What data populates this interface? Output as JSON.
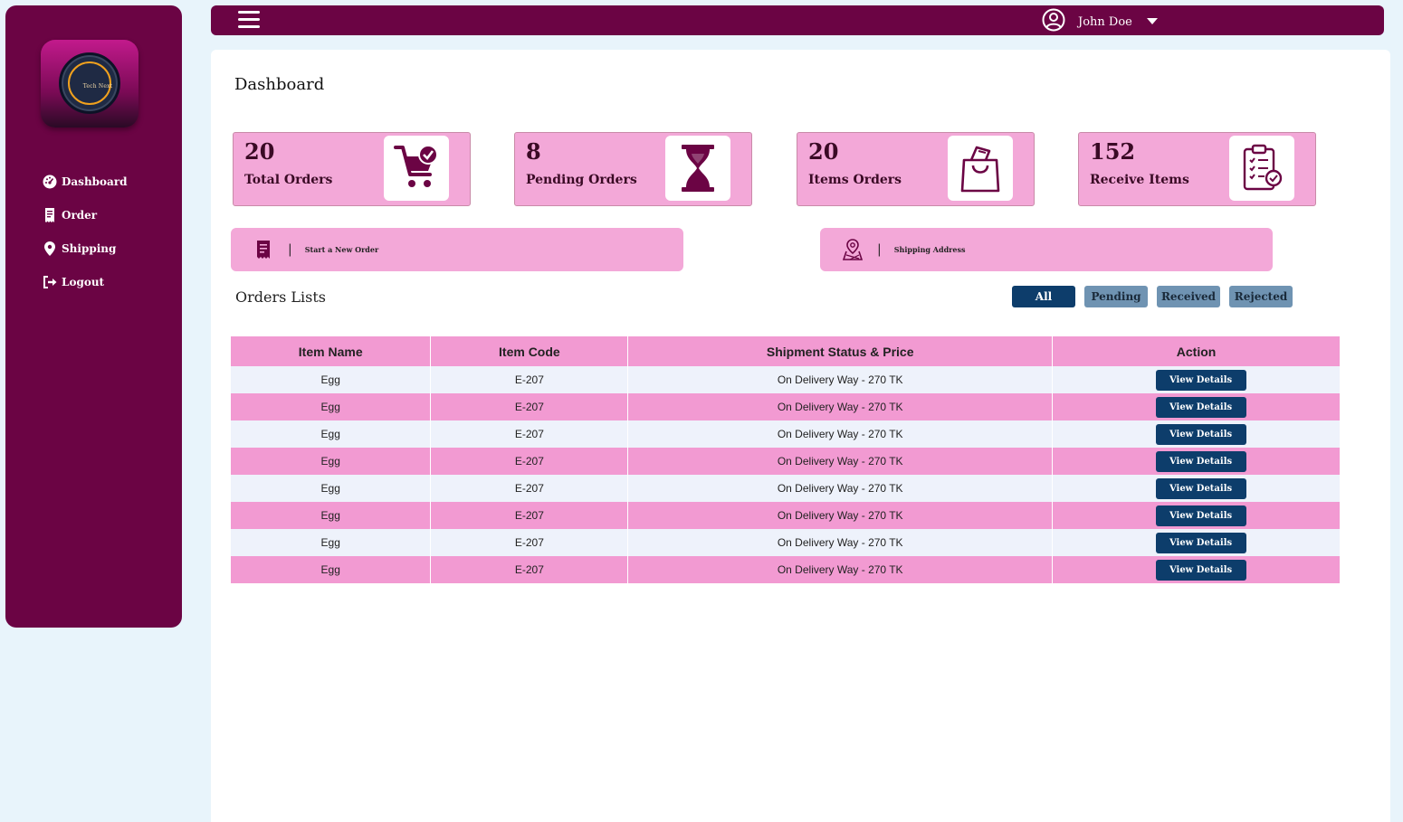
{
  "sidebar": {
    "logo_text": "Tech Next",
    "items": [
      {
        "label": "Dashboard",
        "icon": "dashboard-icon"
      },
      {
        "label": "Order",
        "icon": "receipt-icon"
      },
      {
        "label": "Shipping",
        "icon": "location-pin-icon"
      },
      {
        "label": "Logout",
        "icon": "logout-icon"
      }
    ]
  },
  "topbar": {
    "user_name": "John Doe"
  },
  "main": {
    "title": "Dashboard",
    "stats": [
      {
        "value": "20",
        "label": "Total Orders",
        "icon": "cart-check-icon"
      },
      {
        "value": "8",
        "label": "Pending Orders",
        "icon": "hourglass-icon"
      },
      {
        "value": "20",
        "label": "Items Orders",
        "icon": "shopping-bag-icon"
      },
      {
        "value": "152",
        "label": "Receive Items",
        "icon": "clipboard-checklist-icon"
      }
    ],
    "actions": [
      {
        "label": "Start a New Order",
        "separator": "|",
        "icon": "receipt-icon"
      },
      {
        "label": "Shipping Address",
        "separator": "|",
        "icon": "map-pin-icon"
      }
    ],
    "orders_title": "Orders Lists",
    "filters": [
      "All",
      "Pending",
      "Received",
      "Rejected"
    ],
    "table": {
      "headers": [
        "Item Name",
        "Item Code",
        "Shipment Status & Price",
        "Action"
      ],
      "rows": [
        {
          "name": "Egg",
          "code": "E-207",
          "status": "On Delivery Way - 270 TK",
          "action": "View Details"
        },
        {
          "name": "Egg",
          "code": "E-207",
          "status": "On Delivery Way - 270 TK",
          "action": "View Details"
        },
        {
          "name": "Egg",
          "code": "E-207",
          "status": "On Delivery Way - 270 TK",
          "action": "View Details"
        },
        {
          "name": "Egg",
          "code": "E-207",
          "status": "On Delivery Way - 270 TK",
          "action": "View Details"
        },
        {
          "name": "Egg",
          "code": "E-207",
          "status": "On Delivery Way - 270 TK",
          "action": "View Details"
        },
        {
          "name": "Egg",
          "code": "E-207",
          "status": "On Delivery Way - 270 TK",
          "action": "View Details"
        },
        {
          "name": "Egg",
          "code": "E-207",
          "status": "On Delivery Way - 270 TK",
          "action": "View Details"
        },
        {
          "name": "Egg",
          "code": "E-207",
          "status": "On Delivery Way - 270 TK",
          "action": "View Details"
        }
      ]
    }
  },
  "colors": {
    "brand": "#6b0444",
    "card_pink": "#f3a8d8",
    "table_pink": "#f29ad2",
    "button_navy": "#0d3d6b",
    "filter_inactive": "#6f93b2"
  }
}
